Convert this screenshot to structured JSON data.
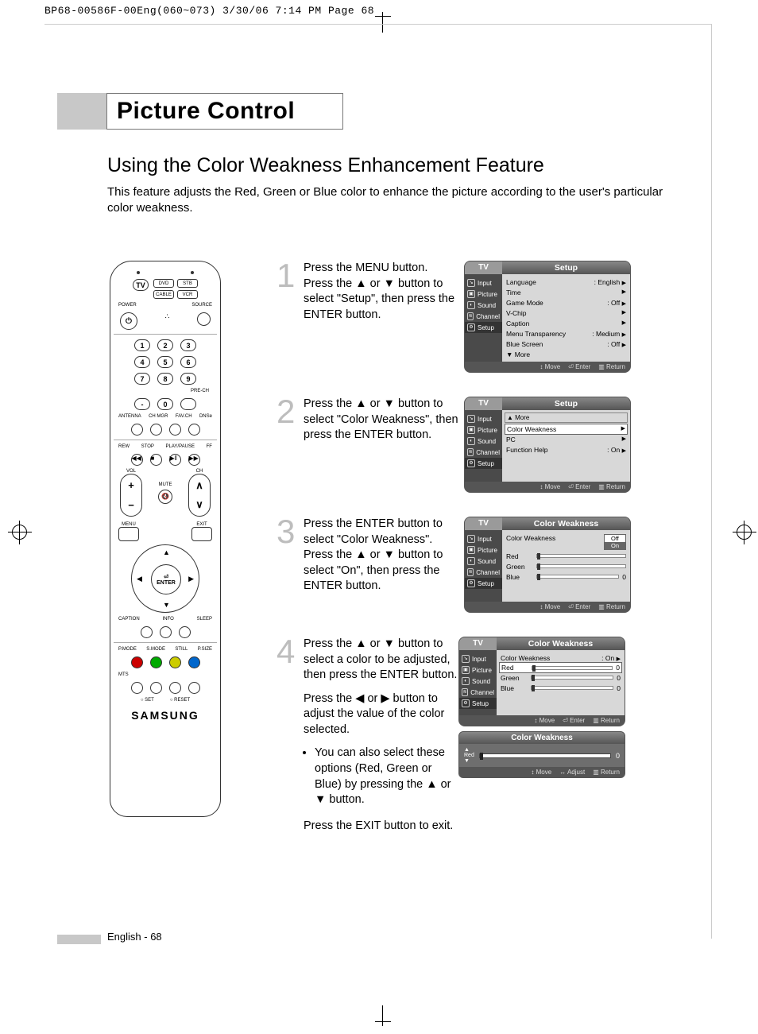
{
  "print_header": "BP68-00586F-00Eng(060~073)  3/30/06  7:14 PM  Page 68",
  "section_title": "Picture Control",
  "subheading": "Using the Color Weakness Enhancement Feature",
  "intro": "This feature adjusts the Red, Green or Blue color to enhance the picture according to the user's particular color weakness.",
  "remote": {
    "src_pills": [
      "DVD",
      "STB",
      "CABLE",
      "VCR"
    ],
    "tv": "TV",
    "power": "POWER",
    "source": "SOURCE",
    "nums": [
      "1",
      "2",
      "3",
      "4",
      "5",
      "6",
      "7",
      "8",
      "9",
      "-",
      "0"
    ],
    "prech": "PRE-CH",
    "small_row": [
      "ANTENNA",
      "CH MGR",
      "FAV.CH",
      "DNSe"
    ],
    "trans_row": [
      "REW",
      "STOP",
      "PLAY/PAUSE",
      "FF"
    ],
    "vol": "VOL",
    "mute": "MUTE",
    "ch": "CH",
    "menu": "MENU",
    "exit": "EXIT",
    "enter": "ENTER",
    "bot_row1": [
      "CAPTION",
      "INFO",
      "SLEEP"
    ],
    "bot_row2": [
      "P.MODE",
      "S.MODE",
      "STILL",
      "P.SIZE"
    ],
    "mts": "MTS",
    "set": "SET",
    "reset": "RESET",
    "brand": "SAMSUNG"
  },
  "steps": [
    {
      "num": "1",
      "text": "Press the MENU button. Press the ▲ or ▼ button to select \"Setup\", then press the ENTER button.",
      "osd": {
        "tv": "TV",
        "title": "Setup",
        "side": [
          "Input",
          "Picture",
          "Sound",
          "Channel",
          "Setup"
        ],
        "rows": [
          {
            "k": "Language",
            "v": ": English",
            "a": "▶"
          },
          {
            "k": "Time",
            "v": "",
            "a": "▶"
          },
          {
            "k": "Game Mode",
            "v": ": Off",
            "a": "▶"
          },
          {
            "k": "V-Chip",
            "v": "",
            "a": "▶"
          },
          {
            "k": "Caption",
            "v": "",
            "a": "▶"
          },
          {
            "k": "Menu Transparency",
            "v": ": Medium",
            "a": "▶"
          },
          {
            "k": "Blue Screen",
            "v": ": Off",
            "a": "▶"
          }
        ],
        "more": "▼ More",
        "bottom": [
          "Move",
          "Enter",
          "Return"
        ]
      }
    },
    {
      "num": "2",
      "text": "Press the ▲ or ▼ button to select \"Color Weakness\", then press the ENTER button.",
      "osd": {
        "tv": "TV",
        "title": "Setup",
        "side": [
          "Input",
          "Picture",
          "Sound",
          "Channel",
          "Setup"
        ],
        "pre_more": "▲ More",
        "rows": [
          {
            "k": "Color Weakness",
            "v": "",
            "a": "▶",
            "hl": true
          },
          {
            "k": "PC",
            "v": "",
            "a": "▶"
          },
          {
            "k": "Function Help",
            "v": ": On",
            "a": "▶"
          }
        ],
        "bottom": [
          "Move",
          "Enter",
          "Return"
        ]
      }
    },
    {
      "num": "3",
      "text": "Press the ENTER button to select \"Color Weakness\". Press the ▲ or ▼ button to select \"On\", then press the ENTER button.",
      "osd": {
        "tv": "TV",
        "title": "Color Weakness",
        "side": [
          "Input",
          "Picture",
          "Sound",
          "Channel",
          "Setup"
        ],
        "cw_toggle": {
          "off": "Off",
          "on": "On"
        },
        "rgb": [
          {
            "k": "Color Weakness"
          },
          {
            "k": "Red"
          },
          {
            "k": "Green"
          },
          {
            "k": "Blue",
            "v": "0"
          }
        ],
        "bottom": [
          "Move",
          "Enter",
          "Return"
        ]
      }
    },
    {
      "num": "4",
      "text1": "Press the ▲ or ▼ button to select a color to be adjusted, then press the ENTER button.",
      "text2": "Press the ◀ or ▶ button to adjust the value of the color selected.",
      "bullet": "You can also select these options (Red, Green or Blue) by pressing the ▲ or ▼ button.",
      "osd": {
        "tv": "TV",
        "title": "Color Weakness",
        "side": [
          "Input",
          "Picture",
          "Sound",
          "Channel",
          "Setup"
        ],
        "rows": [
          {
            "k": "Color Weakness",
            "v": ": On",
            "a": "▶"
          },
          {
            "k": "Red",
            "slider": true,
            "sv": "0",
            "hl": true
          },
          {
            "k": "Green",
            "slider": true,
            "sv": "0"
          },
          {
            "k": "Blue",
            "slider": true,
            "sv": "0"
          }
        ],
        "bottom": [
          "Move",
          "Enter",
          "Return"
        ]
      },
      "mini": {
        "title": "Color Weakness",
        "label": "Red",
        "value": "0",
        "bottom": [
          "Move",
          "Adjust",
          "Return"
        ]
      }
    }
  ],
  "exit_line": "Press the EXIT button to exit.",
  "footer": "English - 68"
}
